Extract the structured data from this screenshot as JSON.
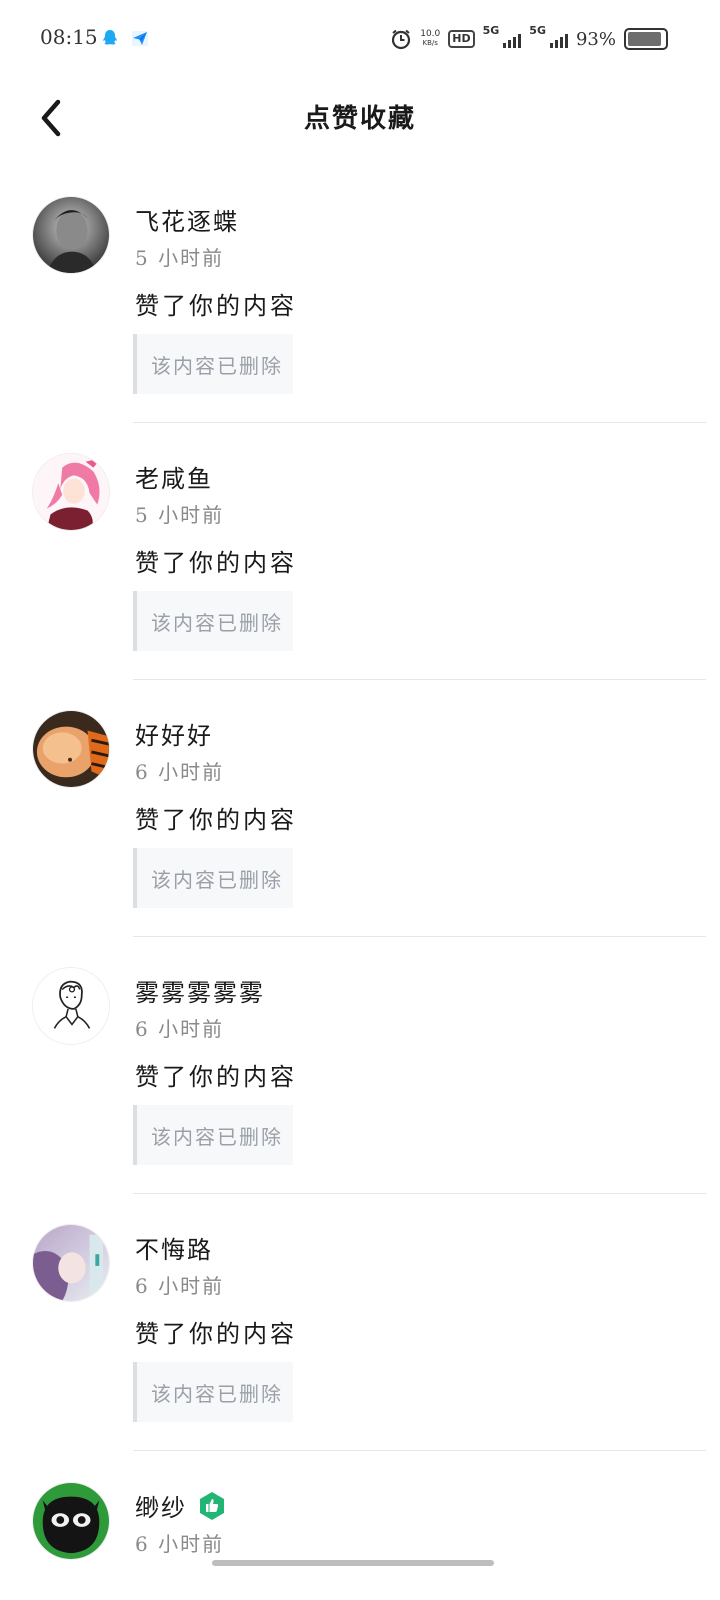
{
  "status_bar": {
    "time": "08:15",
    "net_speed_value": "10.0",
    "net_speed_unit": "KB/s",
    "hd": "HD",
    "sim1_label": "5G",
    "sim2_label": "5G",
    "battery_pct": "93%",
    "battery_level": 0.93
  },
  "header": {
    "title": "点赞收藏"
  },
  "notifications": [
    {
      "name": "飞花逐蝶",
      "time": "5 小时前",
      "action": "赞了你的内容",
      "content": "该内容已删除"
    },
    {
      "name": "老咸鱼",
      "time": "5 小时前",
      "action": "赞了你的内容",
      "content": "该内容已删除"
    },
    {
      "name": "好好好",
      "time": "6 小时前",
      "action": "赞了你的内容",
      "content": "该内容已删除"
    },
    {
      "name": "雾雾雾雾雾",
      "time": "6 小时前",
      "action": "赞了你的内容",
      "content": "该内容已删除"
    },
    {
      "name": "不悔路",
      "time": "6 小时前",
      "action": "赞了你的内容",
      "content": "该内容已删除"
    },
    {
      "name": "缈纱",
      "time": "6 小时前"
    }
  ],
  "colors": {
    "accent_green": "#22b573"
  }
}
